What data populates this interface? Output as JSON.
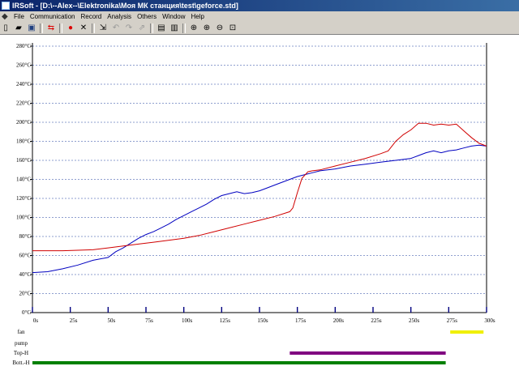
{
  "window": {
    "title": "IRSoft - [D:\\--Alex--\\Elektronika\\Моя МК станция\\test\\geforce.std]"
  },
  "menu": [
    "File",
    "Communication",
    "Record",
    "Analysis",
    "Others",
    "Window",
    "Help"
  ],
  "toolbar": {
    "buttons": [
      "new-icon",
      "open-icon",
      "save-icon",
      "swap-icon",
      "record-icon",
      "stop-icon",
      "import-icon",
      "undo-icon",
      "redo-icon",
      "send-icon",
      "preview-icon",
      "print-icon",
      "zoom-fit-icon",
      "zoom-in-icon",
      "zoom-out-icon",
      "zoom-window-icon"
    ]
  },
  "chart_data": {
    "type": "line",
    "ylim": [
      0,
      280
    ],
    "xlim": [
      0,
      300
    ],
    "y_ticks": [
      "0°C",
      "20°C",
      "40°C",
      "60°C",
      "80°C",
      "100°C",
      "120°C",
      "140°C",
      "160°C",
      "180°C",
      "200°C",
      "220°C",
      "240°C",
      "260°C",
      "280°C"
    ],
    "x_ticks": [
      "0s",
      "25s",
      "50s",
      "75s",
      "100s",
      "125s",
      "150s",
      "175s",
      "200s",
      "225s",
      "250s",
      "275s",
      "300s"
    ],
    "grid": "horizontal dashed",
    "series": [
      {
        "color": "#0000c0",
        "x": [
          0,
          10,
          20,
          30,
          40,
          50,
          55,
          60,
          65,
          70,
          75,
          80,
          85,
          90,
          95,
          100,
          105,
          110,
          115,
          120,
          125,
          130,
          135,
          140,
          145,
          150,
          155,
          160,
          165,
          170,
          175,
          180,
          185,
          190,
          195,
          200,
          210,
          220,
          230,
          240,
          250,
          255,
          260,
          265,
          270,
          275,
          280,
          285,
          290,
          295,
          300
        ],
        "values": [
          42,
          43,
          46,
          50,
          55,
          58,
          64,
          68,
          73,
          78,
          82,
          85,
          89,
          93,
          98,
          102,
          106,
          110,
          114,
          119,
          123,
          125,
          127,
          125,
          126,
          128,
          131,
          134,
          137,
          140,
          143,
          145,
          147,
          149,
          150,
          151,
          154,
          156,
          158,
          160,
          162,
          165,
          168,
          170,
          168,
          170,
          171,
          173,
          175,
          176,
          175
        ]
      },
      {
        "color": "#d00000",
        "x": [
          0,
          20,
          40,
          50,
          60,
          70,
          80,
          100,
          110,
          120,
          130,
          140,
          150,
          160,
          170,
          172,
          175,
          178,
          182,
          185,
          190,
          200,
          210,
          220,
          230,
          235,
          240,
          245,
          250,
          255,
          260,
          265,
          270,
          275,
          280,
          285,
          290,
          295,
          300
        ],
        "values": [
          65,
          65,
          66,
          68,
          70,
          72,
          74,
          78,
          81,
          85,
          89,
          93,
          97,
          101,
          106,
          110,
          126,
          141,
          148,
          149,
          150,
          154,
          158,
          162,
          167,
          170,
          180,
          187,
          192,
          199,
          199,
          197,
          198,
          197,
          198,
          191,
          184,
          178,
          175
        ]
      }
    ],
    "tracks": [
      {
        "label": "fan",
        "color": "#f0f000",
        "x_start": 276,
        "x_end": 298
      },
      {
        "label": "pump",
        "color": "",
        "x_start": null,
        "x_end": null
      },
      {
        "label": "Top-H",
        "color": "#800080",
        "x_start": 170,
        "x_end": 273
      },
      {
        "label": "Bott.-H",
        "color": "#008000",
        "x_start": 0,
        "x_end": 273
      }
    ]
  }
}
